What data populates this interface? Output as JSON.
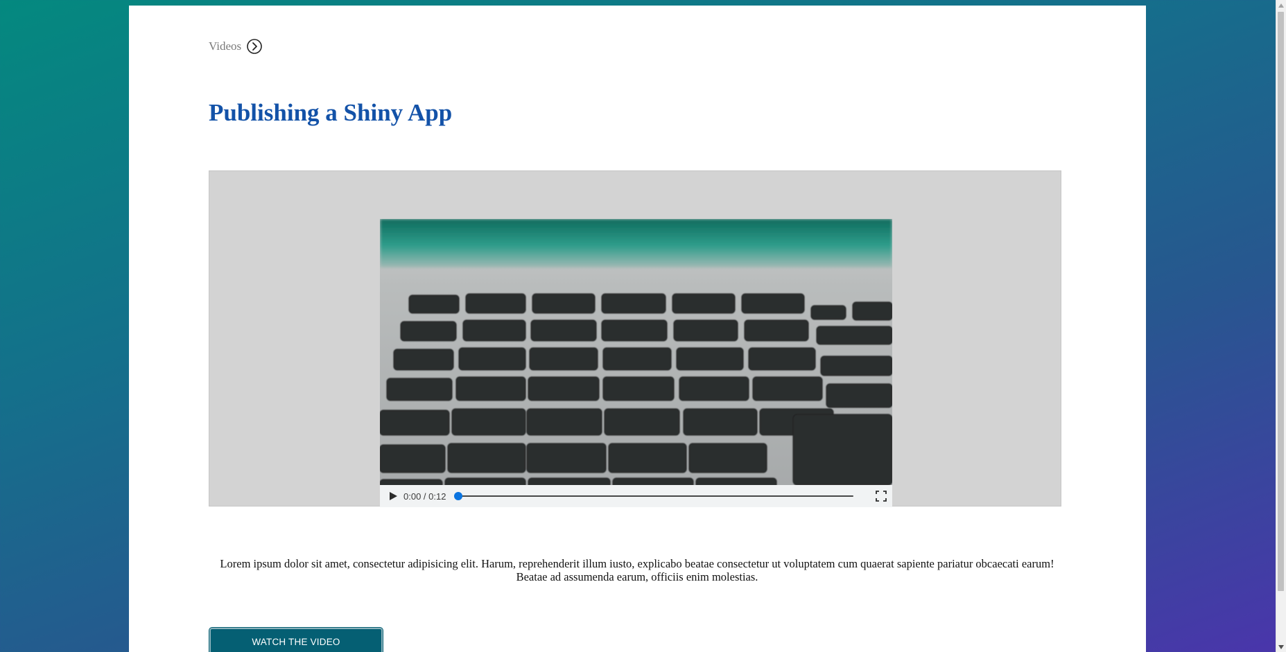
{
  "breadcrumb": {
    "label": "Videos",
    "icon": "circle-chevron-right-icon"
  },
  "page": {
    "title": "Publishing a Shiny App",
    "description": "Lorem ipsum dolor sit amet, consectetur adipisicing elit. Harum, reprehenderit illum iusto, explicabo beatae consectetur ut voluptatem cum quaerat sapiente pariatur obcaecati earum! Beatae ad assumenda earum, officiis enim molestias."
  },
  "video": {
    "poster": "laptop-keyboard-image",
    "current_time": "0:00",
    "duration": "0:12",
    "time_display": "0:00 / 0:12",
    "progress": 0,
    "icons": {
      "play": "play-icon",
      "fullscreen": "fullscreen-icon"
    }
  },
  "actions": {
    "watch_label": "WATCH THE VIDEO"
  },
  "colors": {
    "title": "#1352a8",
    "button": "#055f73",
    "panel": "#d3d3d3",
    "seek_thumb": "#0a74e0"
  }
}
